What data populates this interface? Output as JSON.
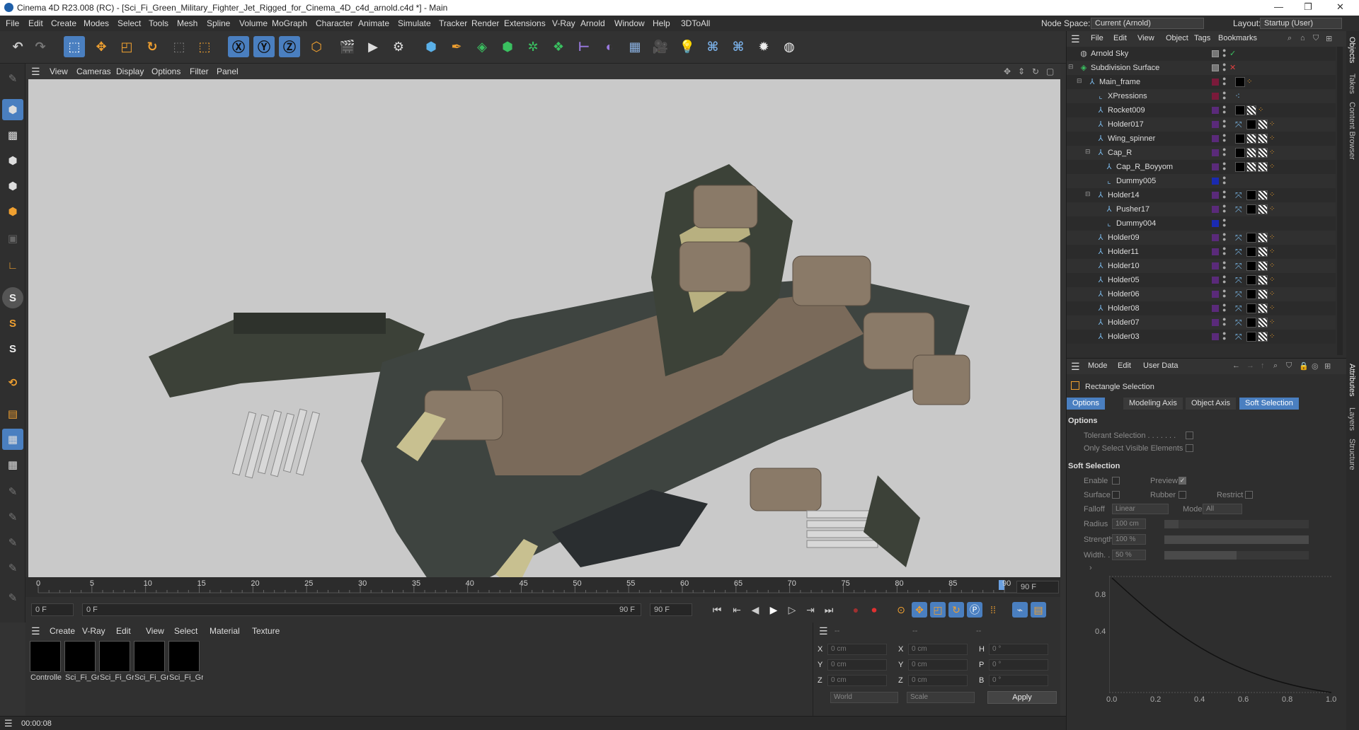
{
  "title": "Cinema 4D R23.008 (RC) - [Sci_Fi_Green_Military_Fighter_Jet_Rigged_for_Cinema_4D_c4d_arnold.c4d *] - Main",
  "menu": [
    "File",
    "Edit",
    "Create",
    "Modes",
    "Select",
    "Tools",
    "Mesh",
    "Spline",
    "Volume",
    "MoGraph",
    "Character",
    "Animate",
    "Simulate",
    "Tracker",
    "Render",
    "Extensions",
    "V-Ray",
    "Arnold",
    "Window",
    "Help",
    "3DToAll"
  ],
  "node_space": {
    "label": "Node Space:",
    "value": "Current (Arnold)"
  },
  "layout": {
    "label": "Layout:",
    "value": "Startup (User)"
  },
  "viewport_menu": [
    "View",
    "Cameras",
    "Display",
    "Options",
    "Filter",
    "Panel"
  ],
  "timeline": {
    "ticks": [
      "0",
      "5",
      "10",
      "15",
      "20",
      "25",
      "30",
      "35",
      "40",
      "45",
      "50",
      "55",
      "60",
      "65",
      "70",
      "75",
      "80",
      "85",
      "90"
    ],
    "current_frame": "90 F"
  },
  "transport": {
    "start": "0 F",
    "cur": "0 F",
    "range_end": "90 F",
    "end": "90 F"
  },
  "material_menu": [
    "Create",
    "V-Ray",
    "Edit",
    "View",
    "Select",
    "Material",
    "Texture"
  ],
  "materials": [
    "Controlle",
    "Sci_Fi_Gr",
    "Sci_Fi_Gr",
    "Sci_Fi_Gr",
    "Sci_Fi_Gr"
  ],
  "coords": {
    "header": [
      "--",
      "--",
      "--"
    ],
    "rows": [
      {
        "a": "X",
        "av": "0 cm",
        "b": "X",
        "bv": "0 cm",
        "c": "H",
        "cv": "0 °"
      },
      {
        "a": "Y",
        "av": "0 cm",
        "b": "Y",
        "bv": "0 cm",
        "c": "P",
        "cv": "0 °"
      },
      {
        "a": "Z",
        "av": "0 cm",
        "b": "Z",
        "bv": "0 cm",
        "c": "B",
        "cv": "0 °"
      }
    ],
    "space": "World",
    "mode": "Scale",
    "apply": "Apply"
  },
  "status_time": "00:00:08",
  "obj_menu": [
    "File",
    "Edit",
    "View",
    "Object",
    "Tags",
    "Bookmarks"
  ],
  "objects": [
    {
      "name": "Arnold Sky",
      "indent": 0,
      "layer": "",
      "tags": ""
    },
    {
      "name": "Subdivision Surface",
      "indent": 0,
      "layer": "",
      "tags": ""
    },
    {
      "name": "Main_frame",
      "indent": 1,
      "layer": "#7a1a3a",
      "tags": "b o"
    },
    {
      "name": "XPressions",
      "indent": 2,
      "layer": "#7a1a3a",
      "tags": "x"
    },
    {
      "name": "Rocket009",
      "indent": 2,
      "layer": "#5a2a7a",
      "tags": "b c o"
    },
    {
      "name": "Holder017",
      "indent": 2,
      "layer": "#5a2a7a",
      "tags": "p b c o"
    },
    {
      "name": "Wing_spinner",
      "indent": 2,
      "layer": "#5a2a7a",
      "tags": "b c c o"
    },
    {
      "name": "Cap_R",
      "indent": 2,
      "layer": "#5a2a7a",
      "tags": "b c c o"
    },
    {
      "name": "Cap_R_Boyyom",
      "indent": 3,
      "layer": "#5a2a7a",
      "tags": "b c c o"
    },
    {
      "name": "Dummy005",
      "indent": 3,
      "layer": "#1a2ab0",
      "tags": ""
    },
    {
      "name": "Holder14",
      "indent": 2,
      "layer": "#5a2a7a",
      "tags": "p b c o"
    },
    {
      "name": "Pusher17",
      "indent": 3,
      "layer": "#5a2a7a",
      "tags": "p b c o"
    },
    {
      "name": "Dummy004",
      "indent": 3,
      "layer": "#1a2ab0",
      "tags": ""
    },
    {
      "name": "Holder09",
      "indent": 2,
      "layer": "#5a2a7a",
      "tags": "p b c o"
    },
    {
      "name": "Holder11",
      "indent": 2,
      "layer": "#5a2a7a",
      "tags": "p b c o"
    },
    {
      "name": "Holder10",
      "indent": 2,
      "layer": "#5a2a7a",
      "tags": "p b c o"
    },
    {
      "name": "Holder05",
      "indent": 2,
      "layer": "#5a2a7a",
      "tags": "p b c o"
    },
    {
      "name": "Holder06",
      "indent": 2,
      "layer": "#5a2a7a",
      "tags": "p b c o"
    },
    {
      "name": "Holder08",
      "indent": 2,
      "layer": "#5a2a7a",
      "tags": "p b c o"
    },
    {
      "name": "Holder07",
      "indent": 2,
      "layer": "#5a2a7a",
      "tags": "p b c o"
    },
    {
      "name": "Holder03",
      "indent": 2,
      "layer": "#5a2a7a",
      "tags": "p b c o"
    }
  ],
  "attr_menu": [
    "Mode",
    "Edit",
    "User Data"
  ],
  "attr_title": "Rectangle Selection",
  "attr_tabs": [
    "Options",
    "Modeling Axis",
    "Object Axis",
    "Soft Selection"
  ],
  "options_hdr": "Options",
  "tolerant": "Tolerant Selection . . . . . . .",
  "only_visible": "Only Select Visible Elements",
  "soft_hdr": "Soft Selection",
  "enable": "Enable",
  "preview": "Preview",
  "surface": "Surface",
  "rubber": "Rubber",
  "restrict": "Restrict",
  "falloff": {
    "label": "Falloff",
    "value": "Linear"
  },
  "mode": {
    "label": "Mode",
    "value": "All"
  },
  "radius": {
    "label": "Radius",
    "value": "100 cm"
  },
  "strength": {
    "label": "Strength",
    "value": "100 %",
    "level": 1.0
  },
  "width": {
    "label": "Width. .",
    "value": "50 %",
    "level": 0.5
  },
  "curve": {
    "y_ticks": [
      "0.8",
      "0.4"
    ],
    "x_ticks": [
      "0.0",
      "0.2",
      "0.4",
      "0.6",
      "0.8",
      "1.0"
    ]
  },
  "side_tabs": [
    "Objects",
    "Takes",
    "Content Browser"
  ],
  "side_tabs2": [
    "Attributes",
    "Layers",
    "Structure"
  ]
}
